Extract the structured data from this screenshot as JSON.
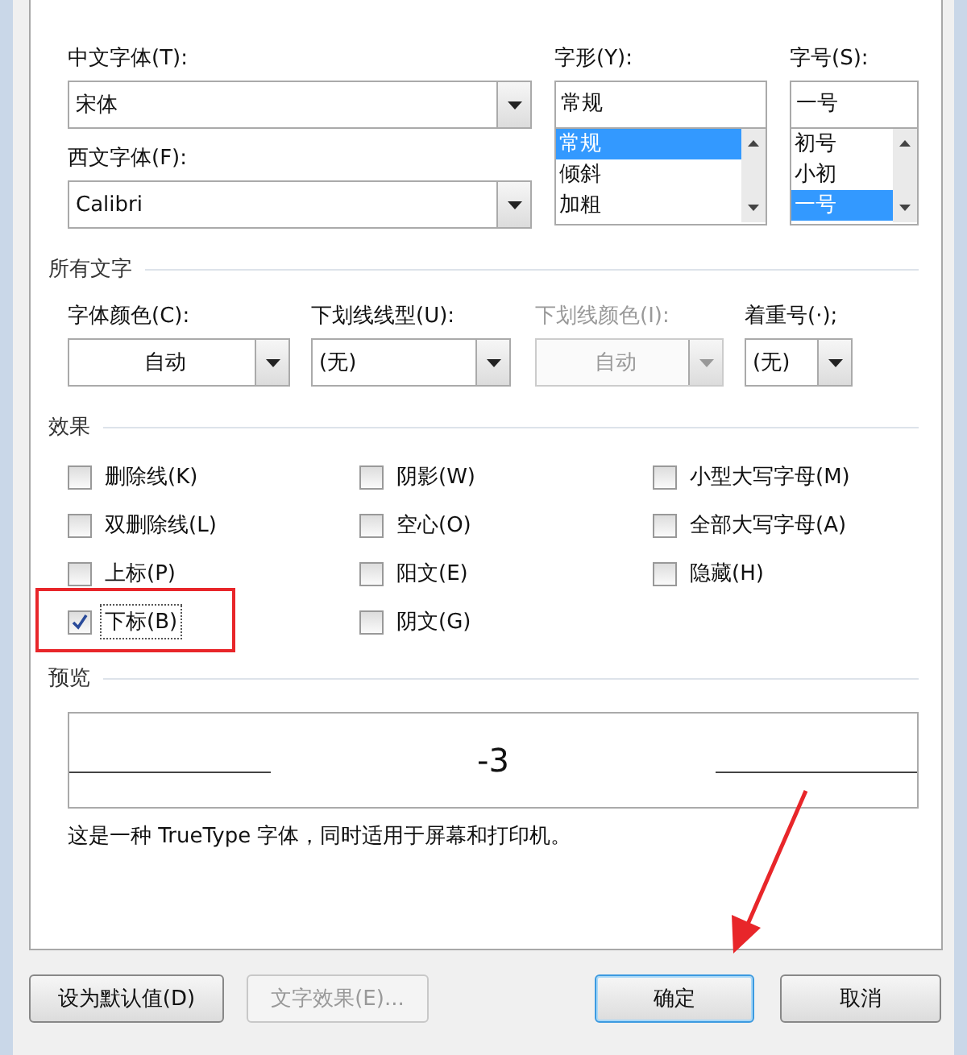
{
  "fonts": {
    "chinese_font": {
      "label": "中文字体(T):",
      "value": "宋体"
    },
    "western_font": {
      "label": "西文字体(F):",
      "value": "Calibri"
    },
    "style": {
      "label": "字形(Y):",
      "value": "常规",
      "options": [
        {
          "text": "常规",
          "selected": true
        },
        {
          "text": "倾斜",
          "selected": false
        },
        {
          "text": "加粗",
          "selected": false
        }
      ]
    },
    "size": {
      "label": "字号(S):",
      "value": "一号",
      "options": [
        {
          "text": "初号",
          "selected": false
        },
        {
          "text": "小初",
          "selected": false
        },
        {
          "text": "一号",
          "selected": true
        }
      ]
    }
  },
  "all_text": {
    "title": "所有文字",
    "fields": [
      {
        "label": "字体颜色(C):",
        "value": "自动",
        "kind": "color",
        "disabled": false
      },
      {
        "label": "下划线线型(U):",
        "value": "(无)",
        "kind": "style",
        "disabled": false
      },
      {
        "label": "下划线颜色(I):",
        "value": "自动",
        "kind": "color",
        "disabled": true
      },
      {
        "label": "着重号(·);",
        "value": "(无)",
        "kind": "style",
        "disabled": false
      }
    ]
  },
  "effects": {
    "title": "效果",
    "options": [
      {
        "label": "删除线(K)",
        "checked": false,
        "highlighted": false
      },
      {
        "label": "阴影(W)",
        "checked": false,
        "highlighted": false
      },
      {
        "label": "小型大写字母(M)",
        "checked": false,
        "highlighted": false
      },
      {
        "label": "双删除线(L)",
        "checked": false,
        "highlighted": false
      },
      {
        "label": "空心(O)",
        "checked": false,
        "highlighted": false
      },
      {
        "label": "全部大写字母(A)",
        "checked": false,
        "highlighted": false
      },
      {
        "label": "上标(P)",
        "checked": false,
        "highlighted": false
      },
      {
        "label": "阳文(E)",
        "checked": false,
        "highlighted": false
      },
      {
        "label": "隐藏(H)",
        "checked": false,
        "highlighted": false
      },
      {
        "label": "下标(B)",
        "checked": true,
        "highlighted": true
      },
      {
        "label": "阴文(G)",
        "checked": false,
        "highlighted": false
      }
    ]
  },
  "preview": {
    "title": "预览",
    "sample": "-3",
    "description": "这是一种 TrueType 字体，同时适用于屏幕和打印机。"
  },
  "buttons": [
    {
      "label": "设为默认值(D)",
      "disabled": false,
      "focused": false
    },
    {
      "label": "文字效果(E)...",
      "disabled": true,
      "focused": false
    },
    {
      "label": "确定",
      "disabled": false,
      "focused": true
    },
    {
      "label": "取消",
      "disabled": false,
      "focused": false
    }
  ]
}
